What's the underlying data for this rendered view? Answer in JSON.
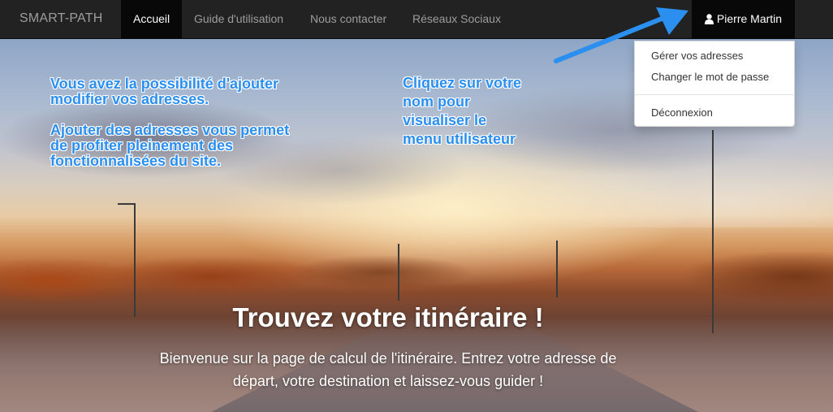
{
  "navbar": {
    "brand": "SMART-PATH",
    "items": [
      {
        "label": "Accueil",
        "active": true
      },
      {
        "label": "Guide d'utilisation",
        "active": false
      },
      {
        "label": "Nous contacter",
        "active": false
      },
      {
        "label": "Réseaux Sociaux",
        "active": false
      }
    ],
    "user": {
      "icon": "user-icon",
      "name": "Pierre Martin"
    }
  },
  "user_menu": {
    "items": [
      "Gérer vos adresses",
      "Changer le mot de passe"
    ],
    "logout": "Déconnexion"
  },
  "annotations": {
    "left": {
      "line1": "Vous avez la possibilité d'ajouter",
      "line2": "modifier vos adresses.",
      "line3": "Ajouter des adresses vous permet",
      "line4": "de profiter pleinement des",
      "line5": "fonctionnalisées du site."
    },
    "center": {
      "line1": "Cliquez sur votre",
      "line2": "nom pour",
      "line3": "visualiser le",
      "line4": "menu utilisateur"
    },
    "color": "#2b8ff0"
  },
  "hero": {
    "title": "Trouvez votre itinéraire !",
    "subtitle_line1": "Bienvenue sur la page de calcul de l'itinéraire. Entrez votre adresse de",
    "subtitle_line2": "départ, votre destination et laissez-vous guider !"
  },
  "colors": {
    "navbar_bg": "#222222",
    "navbar_active_bg": "#080808",
    "nav_text": "#9d9d9d",
    "arrow": "#2b8ff0"
  }
}
